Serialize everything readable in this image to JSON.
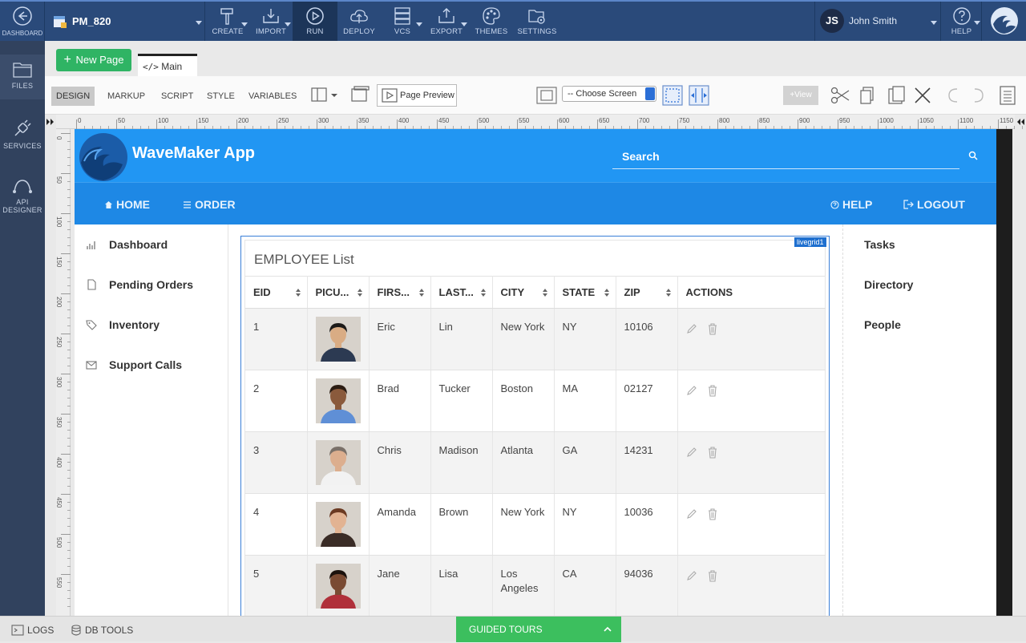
{
  "topbar": {
    "dashboard_label": "DASHBOARD",
    "project_name": "PM_820",
    "items": [
      {
        "label": "CREATE",
        "icon": "hammer-icon"
      },
      {
        "label": "IMPORT",
        "icon": "import-icon"
      },
      {
        "label": "RUN",
        "icon": "play-icon"
      },
      {
        "label": "DEPLOY",
        "icon": "cloud-upload-icon"
      },
      {
        "label": "VCS",
        "icon": "server-icon"
      },
      {
        "label": "EXPORT",
        "icon": "export-icon"
      },
      {
        "label": "THEMES",
        "icon": "palette-icon"
      },
      {
        "label": "SETTINGS",
        "icon": "folder-gear-icon"
      }
    ],
    "user_initials": "JS",
    "user_name": "John Smith",
    "help_label": "HELP"
  },
  "left_rail": [
    {
      "label": "FILES",
      "icon": "folder-icon"
    },
    {
      "label": "SERVICES",
      "icon": "plug-icon"
    },
    {
      "label_line1": "API",
      "label_line2": "DESIGNER",
      "icon": "api-curve-icon"
    }
  ],
  "page_tabs": {
    "new_page_label": "New Page",
    "main_tab_label": "Main"
  },
  "toolbar": {
    "modes": [
      "DESIGN",
      "MARKUP",
      "SCRIPT",
      "STYLE",
      "VARIABLES"
    ],
    "active_mode": "DESIGN",
    "page_preview_label": "Page Preview",
    "screen_select_value": "-- Choose Screen",
    "view_button_label": "+View"
  },
  "ruler": {
    "h_ticks": [
      "0",
      "50",
      "100",
      "150",
      "200",
      "250",
      "300",
      "350",
      "400",
      "450",
      "500",
      "550",
      "600",
      "650",
      "700",
      "750",
      "800",
      "850",
      "900",
      "950",
      "1000",
      "1050",
      "1100",
      "1150"
    ],
    "v_ticks": [
      "0",
      "50",
      "100",
      "150",
      "200",
      "250",
      "300",
      "350",
      "400",
      "450",
      "500",
      "550"
    ]
  },
  "app": {
    "title": "WaveMaker App",
    "search_placeholder": "Search",
    "nav_left": [
      {
        "label": "HOME",
        "icon": "home-icon"
      },
      {
        "label": "ORDER",
        "icon": "list-icon"
      }
    ],
    "nav_right": [
      {
        "label": "HELP",
        "icon": "question-circle-icon"
      },
      {
        "label": "LOGOUT",
        "icon": "logout-icon"
      }
    ],
    "left_menu": [
      {
        "label": "Dashboard",
        "icon": "bar-chart-icon"
      },
      {
        "label": "Pending Orders",
        "icon": "file-icon"
      },
      {
        "label": "Inventory",
        "icon": "tag-icon"
      },
      {
        "label": "Support Calls",
        "icon": "envelope-icon"
      }
    ],
    "right_menu": [
      "Tasks",
      "Directory",
      "People"
    ],
    "grid": {
      "title": "EMPLOYEE List",
      "badge": "livegrid1",
      "columns": [
        "EID",
        "PICU...",
        "FIRS...",
        "LAST...",
        "CITY",
        "STATE",
        "ZIP",
        "ACTIONS"
      ],
      "rows": [
        {
          "eid": "1",
          "first": "Eric",
          "last": "Lin",
          "city": "New York",
          "state": "NY",
          "zip": "10106",
          "skin": "#d9ac84",
          "hair": "#1c1a18",
          "shirt": "#2c3a52"
        },
        {
          "eid": "2",
          "first": "Brad",
          "last": "Tucker",
          "city": "Boston",
          "state": "MA",
          "zip": "02127",
          "skin": "#8a5a3c",
          "hair": "#2b1c13",
          "shirt": "#5f8fd6"
        },
        {
          "eid": "3",
          "first": "Chris",
          "last": "Madison",
          "city": "Atlanta",
          "state": "GA",
          "zip": "14231",
          "skin": "#dcae8e",
          "hair": "#7a7068",
          "shirt": "#f2f2f2"
        },
        {
          "eid": "4",
          "first": "Amanda",
          "last": "Brown",
          "city": "New York",
          "state": "NY",
          "zip": "10036",
          "skin": "#e2b392",
          "hair": "#6b3a22",
          "shirt": "#3a2c26"
        },
        {
          "eid": "5",
          "first": "Jane",
          "last": "Lisa",
          "city": "Los Angeles",
          "state": "CA",
          "zip": "94036",
          "skin": "#7a4b33",
          "hair": "#1b120d",
          "shirt": "#b0303a"
        }
      ]
    }
  },
  "bottombar": {
    "logs_label": "LOGS",
    "dbtools_label": "DB TOOLS",
    "guided_tours_label": "GUIDED TOURS"
  },
  "colors": {
    "topbar": "#2a4a7a",
    "app_header": "#2196f3",
    "app_nav": "#1e88e5",
    "new_page": "#2fb464",
    "guided_tours": "#3cbf5e"
  }
}
